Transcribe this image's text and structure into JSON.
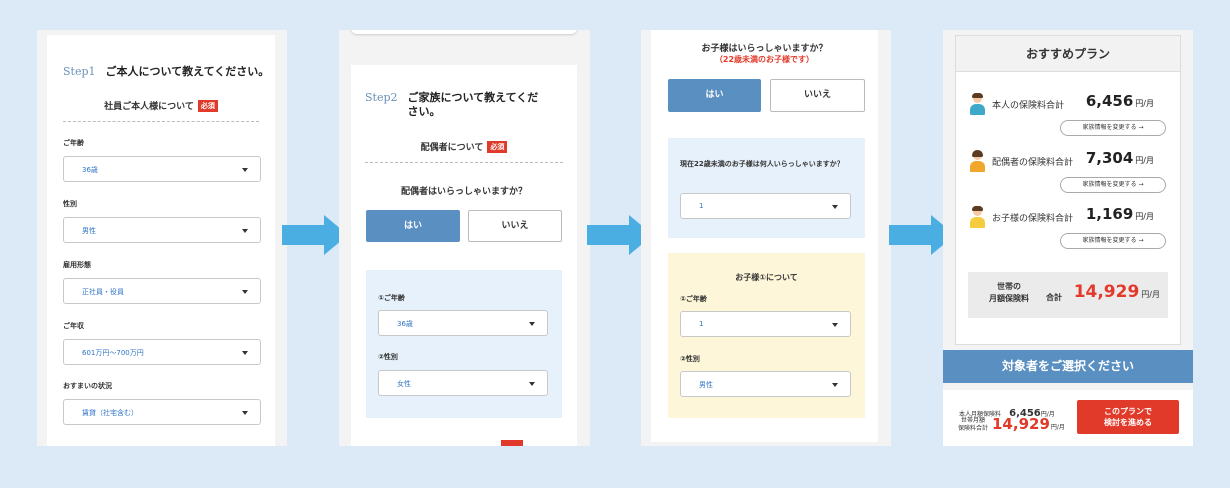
{
  "panel1": {
    "step": "Step1",
    "title": "ご本人について教えてください。",
    "section": "社員ご本人様について",
    "required": "必須",
    "fields": [
      {
        "label": "ご年齢",
        "value": "36歳"
      },
      {
        "label": "性別",
        "value": "男性"
      },
      {
        "label": "雇用形態",
        "value": "正社員・役員"
      },
      {
        "label": "ご年収",
        "value": "601万円～700万円"
      },
      {
        "label": "おすまいの状況",
        "value": "賃貸（社宅含む）"
      }
    ]
  },
  "panel2": {
    "step": "Step2",
    "title": "ご家族について教えてください。",
    "section": "配偶者について",
    "required": "必須",
    "question": "配偶者はいらっしゃいますか？",
    "yes": "はい",
    "no": "いいえ",
    "fields": [
      {
        "label": "①ご年齢",
        "value": "36歳"
      },
      {
        "label": "②性別",
        "value": "女性"
      }
    ]
  },
  "panel3": {
    "question": "お子様はいらっしゃいますか？",
    "note": "（22歳未満のお子様です）",
    "yes": "はい",
    "no": "いいえ",
    "count_question": "現在22歳未満のお子様は何人いらっしゃいますか？",
    "count_value": "1",
    "child_heading": "お子様①について",
    "fields": [
      {
        "label": "①ご年齢",
        "value": "1"
      },
      {
        "label": "②性別",
        "value": "男性"
      }
    ]
  },
  "panel4": {
    "title": "おすすめプラン",
    "rows": [
      {
        "label": "本人の保険料合計",
        "value": "6,456",
        "unit": "円/月",
        "button": "家族情報を変更する →"
      },
      {
        "label": "配偶者の保険料合計",
        "value": "7,304",
        "unit": "円/月",
        "button": "家族情報を変更する →"
      },
      {
        "label": "お子様の保険料合計",
        "value": "1,169",
        "unit": "円/月",
        "button": "家族情報を変更する →"
      }
    ],
    "total_label_1": "世帯の",
    "total_label_2": "月額保険料",
    "total_prefix": "合計",
    "total_value": "14,929",
    "total_unit": "円/月",
    "select_banner": "対象者をご選択ください",
    "footer_self_label": "本人月額保険料",
    "footer_self_value": "6,456",
    "footer_unit": "円/月",
    "footer_total_label_1": "世帯月額",
    "footer_total_label_2": "保険料合計",
    "footer_total_value": "14,929",
    "cta_1": "このプランで",
    "cta_2": "検討を進める"
  },
  "colors": {
    "accent_blue": "#5a8fc1",
    "arrow": "#4aaee3",
    "red": "#e23a2a",
    "background": "#dce9f6"
  }
}
